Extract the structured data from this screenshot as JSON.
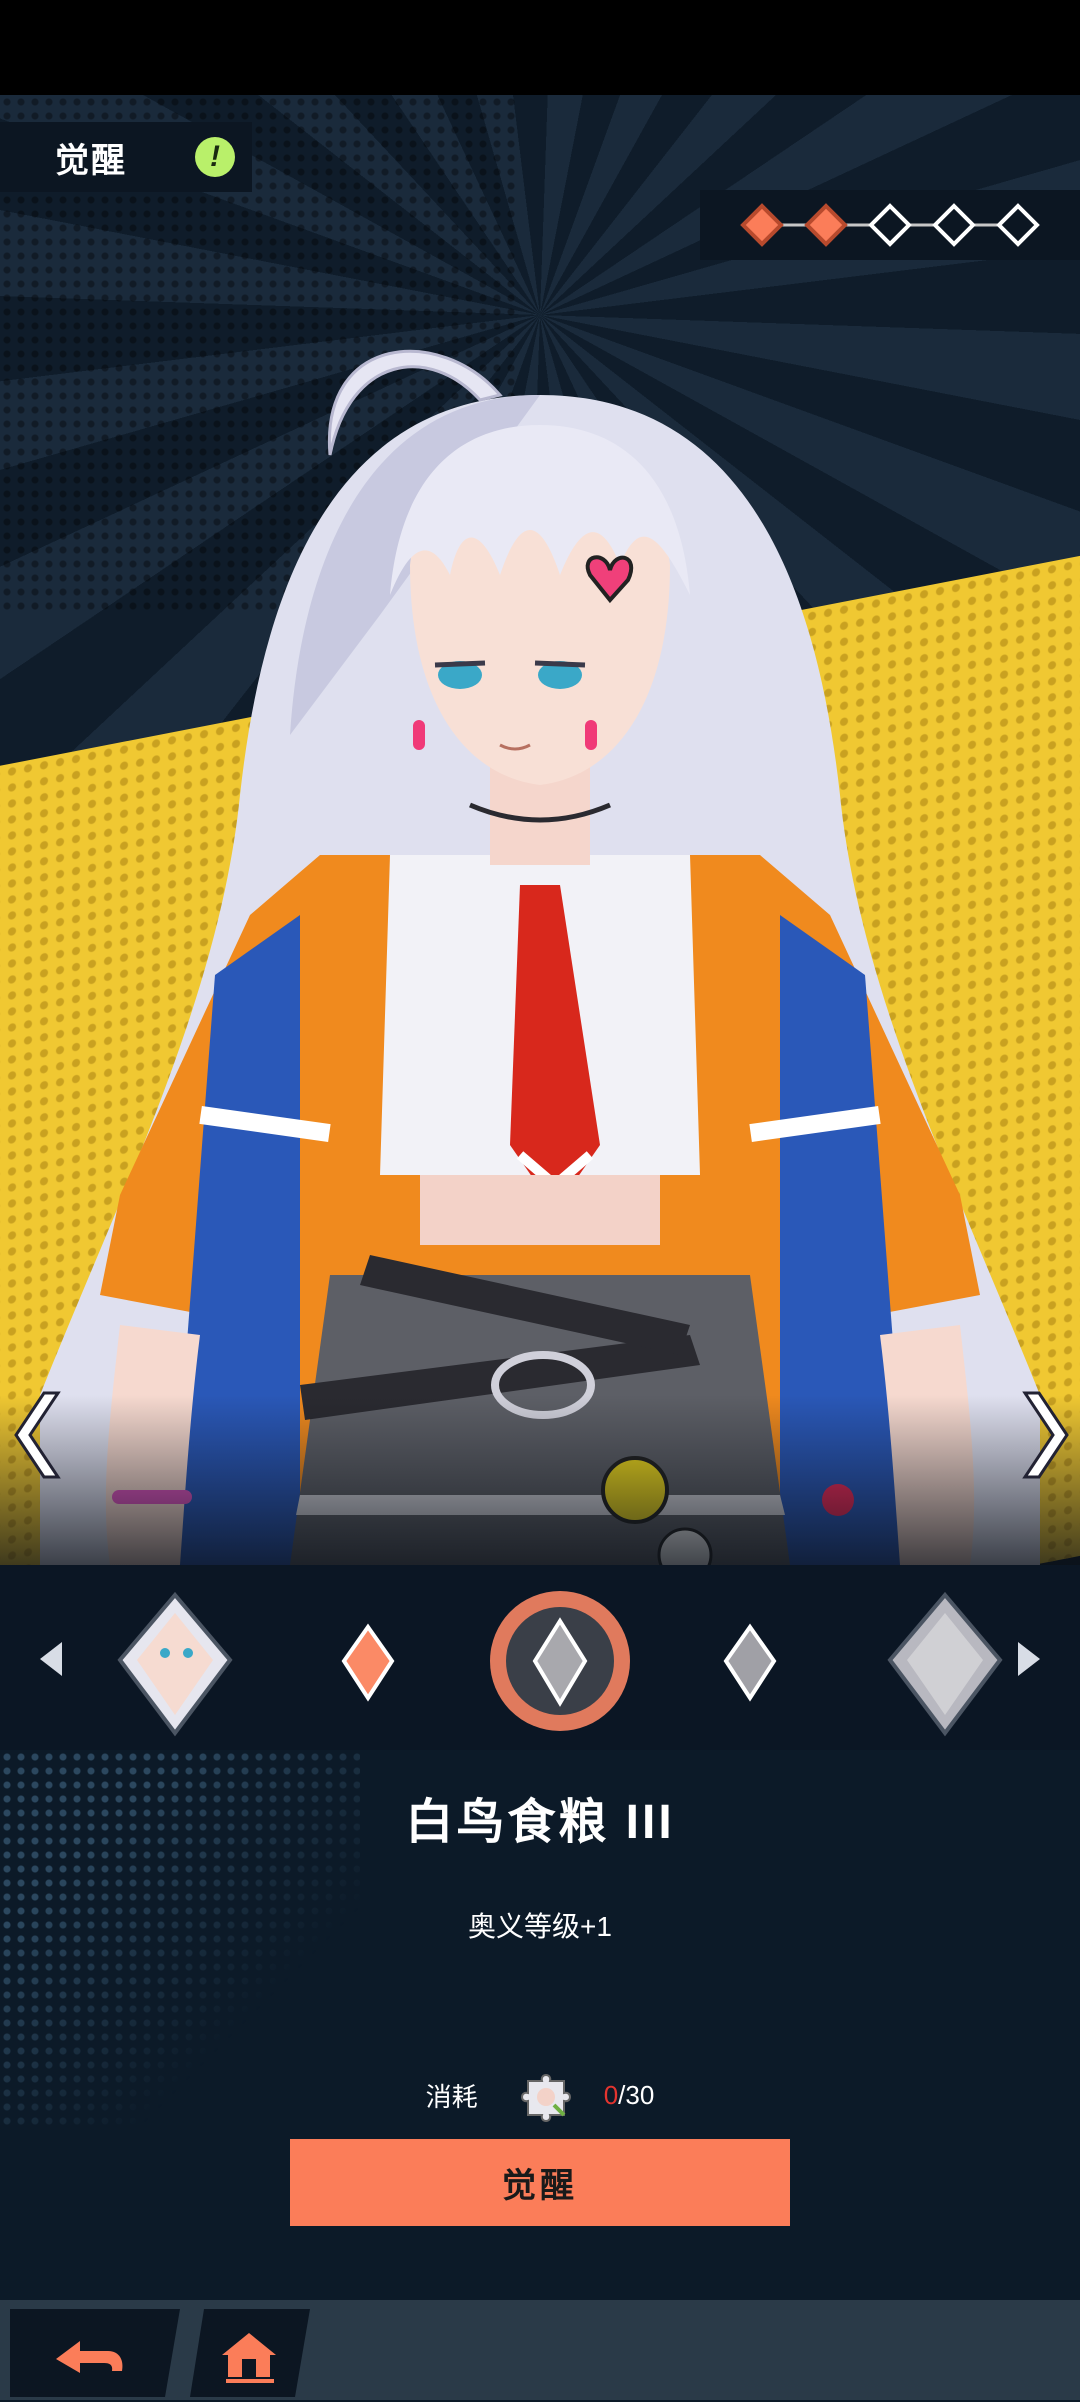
{
  "header": {
    "title": "觉醒",
    "alert_badge": "!",
    "progress": {
      "total": 5,
      "filled": 2
    }
  },
  "colors": {
    "accent": "#fb7d59",
    "badge": "#b9f06a",
    "cost_have": "#e3342f"
  },
  "skill": {
    "name": "白鸟食粮 III",
    "effect": "奥义等级+1"
  },
  "cost": {
    "label": "消耗",
    "have": "0",
    "need": "/30"
  },
  "actions": {
    "awaken_label": "觉醒"
  },
  "icons": {
    "back": "back-arrow-icon",
    "home": "home-icon",
    "prev": "chevron-left-icon",
    "next": "chevron-right-icon"
  }
}
